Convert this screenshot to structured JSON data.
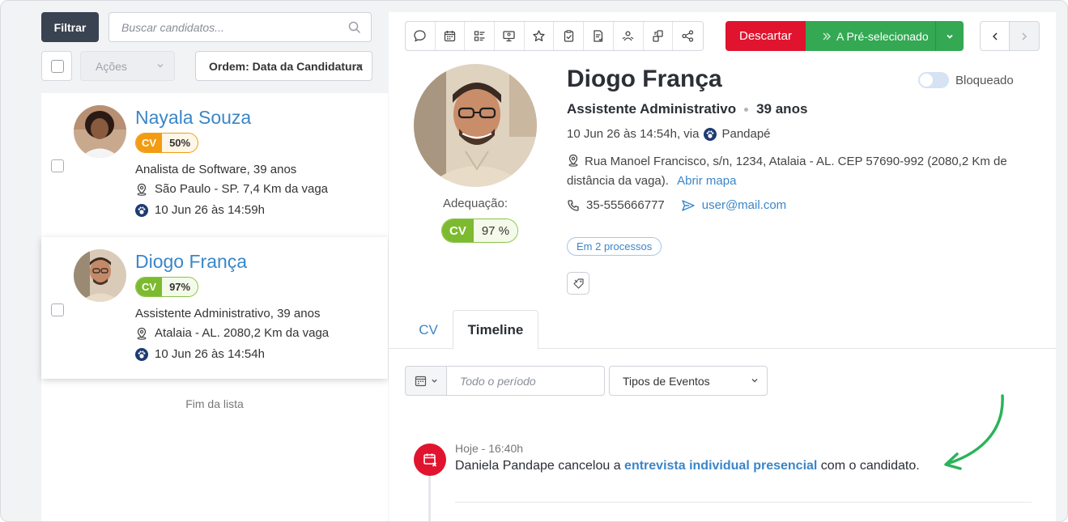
{
  "filter": {
    "button_label": "Filtrar",
    "search_placeholder": "Buscar candidatos..."
  },
  "actions": {
    "label": "Ações"
  },
  "order": {
    "label": "Ordem: Data da Candidatura"
  },
  "candidates": [
    {
      "name": "Nayala Souza",
      "cv_label": "CV",
      "cv_pct": "50%",
      "cv_color": "#f39c12",
      "role": "Analista de Software, 39 anos",
      "location": "São Paulo - SP. 7,4 Km da vaga",
      "date": "10 Jun 26 às 14:59h"
    },
    {
      "name": "Diogo França",
      "cv_label": "CV",
      "cv_pct": "97%",
      "cv_color": "#7cba2f",
      "role": "Assistente Administrativo, 39 anos",
      "location": "Atalaia - AL. 2080,2 Km da vaga",
      "date": "10 Jun 26 às 14:54h"
    }
  ],
  "list_end": "Fim da lista",
  "toolbar": {
    "icons": [
      "chat-icon",
      "calendar-icon",
      "checklist-icon",
      "monitor-icon",
      "star-icon",
      "clipboard-icon",
      "document-icon",
      "people-icon",
      "transfer-icon",
      "share-icon"
    ]
  },
  "actions_bar": {
    "discard_label": "Descartar",
    "advance_label": "A Pré-selecionado",
    "discard_color": "#e0142f",
    "advance_color": "#34a853"
  },
  "profile": {
    "name": "Diogo França",
    "blocked_label": "Bloqueado",
    "role": "Assistente Administrativo",
    "age": "39 anos",
    "date_via": "10 Jun 26 às 14:54h, via",
    "source": "Pandapé",
    "address": "Rua Manoel Francisco, s/n, 1234, Atalaia - AL. CEP 57690-992 (2080,2 Km de distância da vaga).",
    "map_link": "Abrir mapa",
    "phone": "35-555666777",
    "email": "user@mail.com",
    "processes": "Em 2 processos",
    "fit_label": "Adequação:",
    "fit_cv": "CV",
    "fit_pct": "97 %"
  },
  "tabs": [
    {
      "label": "CV"
    },
    {
      "label": "Timeline"
    }
  ],
  "timeline_filters": {
    "period_placeholder": "Todo o período",
    "event_types": "Tipos de Eventos"
  },
  "timeline": [
    {
      "time": "Hoje - 16:40h",
      "text_before": "Daniela Pandape cancelou a ",
      "link": "entrevista individual presencial",
      "text_after": " com o candidato."
    }
  ]
}
